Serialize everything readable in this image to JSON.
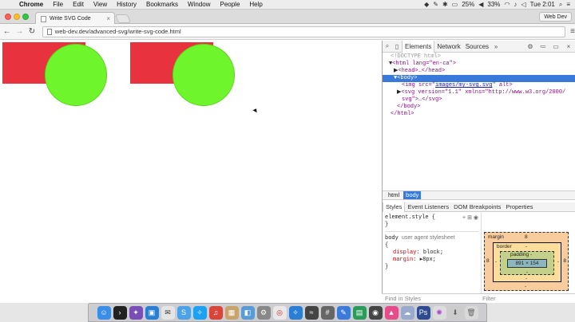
{
  "menubar": {
    "app": "Chrome",
    "items": [
      "File",
      "Edit",
      "View",
      "History",
      "Bookmarks",
      "Window",
      "People",
      "Help"
    ],
    "battery": "25%",
    "volume": "33%",
    "clock": "Tue 2:01"
  },
  "tab": {
    "title": "Write SVG Code"
  },
  "profile": "Web Dev",
  "address": {
    "url": "web-dev.dev/advanced-svg/write-svg-code.html"
  },
  "devtools": {
    "tabs": [
      "Elements",
      "Network",
      "Sources"
    ],
    "active_tab": "Elements",
    "dom": {
      "doctype": "<!DOCTYPE html>",
      "html_open": "<html lang=\"en-ca\">",
      "head": "<head>…</head>",
      "body_open": "<body>",
      "img_prefix": "<img src=\"",
      "img_src": "images/my-svg.svg",
      "img_suffix": "\" alt>",
      "svg_line1": "<svg version=\"1.1\" xmlns=\"http://www.w3.org/2000/",
      "svg_line2": "svg\">…</svg>",
      "body_close": "</body>",
      "html_close": "</html>"
    },
    "breadcrumbs": [
      "html",
      "body"
    ],
    "active_crumb": "body",
    "sidebar_tabs": [
      "Styles",
      "Event Listeners",
      "DOM Breakpoints",
      "Properties"
    ],
    "styles": {
      "element_style": "element.style {",
      "element_close": "}",
      "selector": "body",
      "origin": "user agent stylesheet",
      "open_brace": "{",
      "props": [
        {
          "name": "display",
          "value": "block;"
        },
        {
          "name": "margin",
          "value": "▸8px;"
        }
      ],
      "close_brace": "}"
    },
    "box_model": {
      "margin_label": "margin",
      "margin_value": "8",
      "border_label": "border",
      "border_value": "-",
      "padding_label": "padding -",
      "content": "891 × 154",
      "left": "8",
      "right": "8",
      "inner_left": "-",
      "inner_right": "-",
      "bottom_dash": "-",
      "bottom_dash2": "-",
      "bottom_dash3": "-"
    },
    "filter_left": "Find in Styles",
    "filter_right": "Filter"
  },
  "colors": {
    "rect": "#e8323e",
    "circle": "#6ef52c"
  }
}
